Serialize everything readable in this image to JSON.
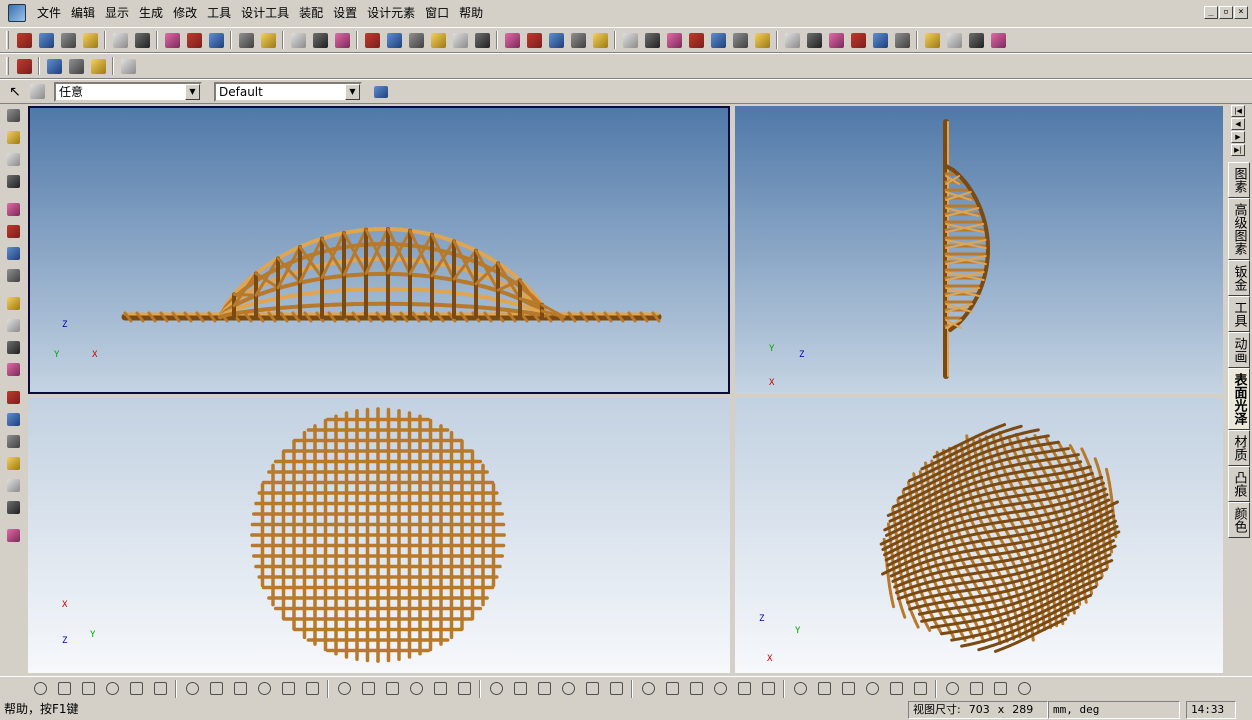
{
  "menu": [
    "文件",
    "编辑",
    "显示",
    "生成",
    "修改",
    "工具",
    "设计工具",
    "装配",
    "设置",
    "设计元素",
    "窗口",
    "帮助"
  ],
  "toolbar1": [
    "new-icon",
    "open-recent-icon",
    "open-icon",
    "save-icon",
    "undo-icon",
    "redo-icon",
    "regenerate-icon",
    "copy-icon",
    "print-icon",
    "find-icon",
    "help-icon",
    "display-icon",
    "shade-icon",
    "solid-icon",
    "extrude-icon",
    "revolve-icon",
    "sweep-icon",
    "blend-icon",
    "datum-icon",
    "plane-icon",
    "axis-icon",
    "point-icon",
    "csys-icon",
    "curve-icon",
    "sketch-icon",
    "hole-icon",
    "round-icon",
    "chamfer-icon",
    "shell-icon",
    "rib-icon",
    "draft-icon",
    "pattern-icon",
    "mirror-icon",
    "merge-icon",
    "trim-icon",
    "offset-icon",
    "thicken-icon",
    "solidify-icon",
    "view-icon",
    "zoom-icon",
    "orient-icon",
    "layer-icon"
  ],
  "toolbar2": [
    "move-icon",
    "layout-icon",
    "layout2-icon",
    "layout3-icon",
    "tool-icon"
  ],
  "filter": {
    "label": "任意",
    "options_selected": "Default"
  },
  "left_tools": [
    "move-view-icon",
    "rotate-icon",
    "pan-icon",
    "spin-icon",
    "zoom-icon",
    "zoom-window-icon",
    "refit-icon",
    "orient-icon",
    "view-icon",
    "camera-icon",
    "snapshot-icon",
    "edit-icon",
    "extrude-icon",
    "cut-icon",
    "surface-icon",
    "merge-icon",
    "shade-icon",
    "render-icon",
    "measure-icon"
  ],
  "viewports": {
    "front": {
      "axes": {
        "z": "Z",
        "y": "Y",
        "x": "X"
      }
    },
    "side": {
      "axes": {
        "y": "Y",
        "z": "Z",
        "x": "X"
      }
    },
    "top": {
      "axes": {
        "x": "X",
        "z": "Z",
        "y": "Y"
      }
    },
    "iso": {
      "axes": {
        "z": "Z",
        "x": "X",
        "y": "Y"
      }
    }
  },
  "right_tabs": [
    "图素",
    "高级图素",
    "钣金",
    "工具",
    "动画",
    "表面光泽",
    "材质",
    "凸痕",
    "颜色"
  ],
  "right_tabs_active": "表面光泽",
  "bottom_tools": 40,
  "status": {
    "help": "帮助，按F1键",
    "view_size_label": "视图尺寸:",
    "view_width": "703",
    "view_x": "x",
    "view_height": "289",
    "units": "mm, deg",
    "time": "14:33"
  },
  "colors": {
    "frame": "#b87a2a",
    "frame_dark": "#7a4a12",
    "frame_light": "#e0a550"
  }
}
